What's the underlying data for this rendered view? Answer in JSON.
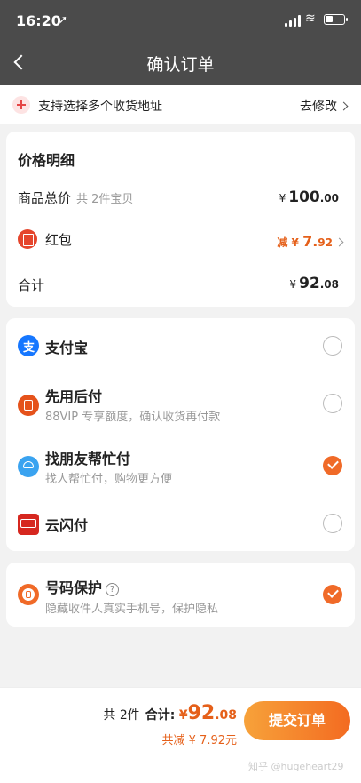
{
  "status_bar": {
    "time": "16:20",
    "location_glyph": "➚",
    "wifi_glyph": "≋"
  },
  "nav": {
    "title": "确认订单"
  },
  "address_banner": {
    "text": "支持选择多个收货地址",
    "action": "去修改"
  },
  "price_detail": {
    "title": "价格明细",
    "goods_total": {
      "label": "商品总价",
      "sub": "共 2件宝贝",
      "currency": "¥",
      "int": "100",
      "dec": ".00"
    },
    "red_packet": {
      "label": "红包",
      "prefix": "减 ¥ ",
      "int": "7.",
      "dec": "92"
    },
    "total": {
      "label": "合计",
      "currency": "¥",
      "int": "92",
      "dec": ".08"
    }
  },
  "payment_methods": [
    {
      "title": "支付宝",
      "desc": "",
      "checked": false,
      "icon": "alipay-icon",
      "color": "#1677ff"
    },
    {
      "title": "先用后付",
      "desc": "88VIP 专享额度，确认收货再付款",
      "checked": false,
      "icon": "pay-later-icon",
      "color": "#e5521b"
    },
    {
      "title": "找朋友帮忙付",
      "desc": "找人帮忙付，购物更方便",
      "checked": true,
      "icon": "friend-pay-icon",
      "color": "#3aa3f0"
    },
    {
      "title": "云闪付",
      "desc": "",
      "checked": false,
      "icon": "unionpay-icon",
      "color": "#d6271f"
    }
  ],
  "number_protection": {
    "title": "号码保护",
    "help": "?",
    "desc": "隐藏收件人真实手机号，保护隐私",
    "checked": true
  },
  "bottom_bar": {
    "count": "共 2件",
    "total_label": "合计:",
    "currency": "¥",
    "int": "92",
    "dec": ".08",
    "savings": "共减 ¥ 7.92元",
    "submit": "提交订单",
    "watermark": "知乎 @hugeheart29"
  },
  "colors": {
    "accent": "#f06a28",
    "nav_bg": "#4b4b4b",
    "page_bg": "#f2f2f2"
  }
}
